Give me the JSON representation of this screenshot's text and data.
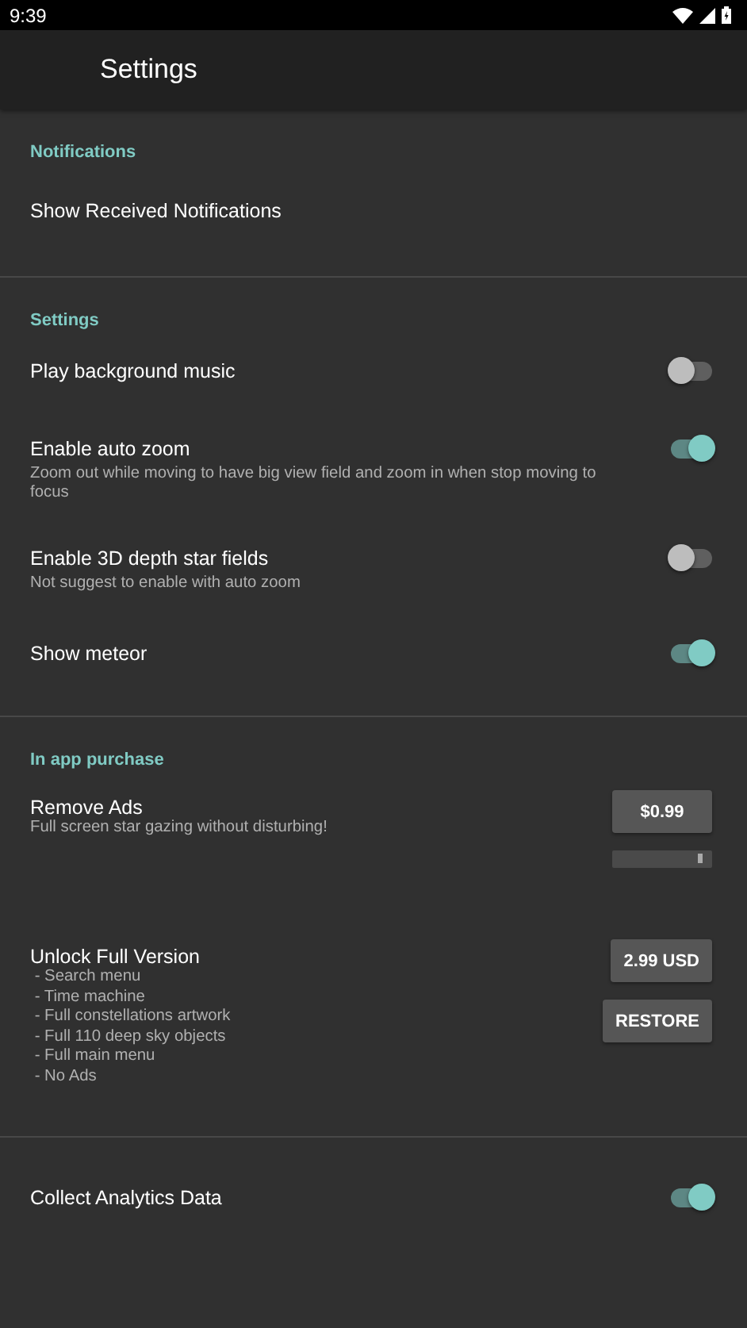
{
  "status_bar": {
    "time": "9:39"
  },
  "toolbar": {
    "title": "Settings"
  },
  "sections": [
    {
      "header": "Notifications",
      "items": [
        {
          "kind": "text",
          "title": "Show Received Notifications"
        }
      ]
    },
    {
      "header": "Settings",
      "items": [
        {
          "kind": "switch",
          "title": "Play background music",
          "on": false
        },
        {
          "kind": "switch",
          "title": "Enable auto zoom",
          "summary": "Zoom out while moving to have big view field and zoom in when stop moving to focus",
          "on": true
        },
        {
          "kind": "switch",
          "title": "Enable 3D depth star fields",
          "summary": "Not suggest to enable with auto zoom",
          "on": false
        },
        {
          "kind": "switch",
          "title": "Show meteor",
          "on": true
        }
      ]
    },
    {
      "header": "In app purchase",
      "items": [
        {
          "kind": "purchase",
          "title": "Remove Ads",
          "lines": [
            "Full screen star gazing without disturbing!"
          ],
          "buttons": [
            "$0.99"
          ],
          "scroll_bar": true
        },
        {
          "kind": "purchase",
          "title": "Unlock Full Version",
          "lines": [
            " - Search menu",
            " - Time machine",
            " - Full constellations artwork",
            " - Full 110 deep sky objects",
            " - Full main menu",
            " - No Ads"
          ],
          "buttons": [
            "2.99 USD",
            "RESTORE"
          ]
        }
      ]
    },
    {
      "items": [
        {
          "kind": "switch",
          "title": "Collect Analytics Data",
          "on": true
        }
      ]
    }
  ]
}
